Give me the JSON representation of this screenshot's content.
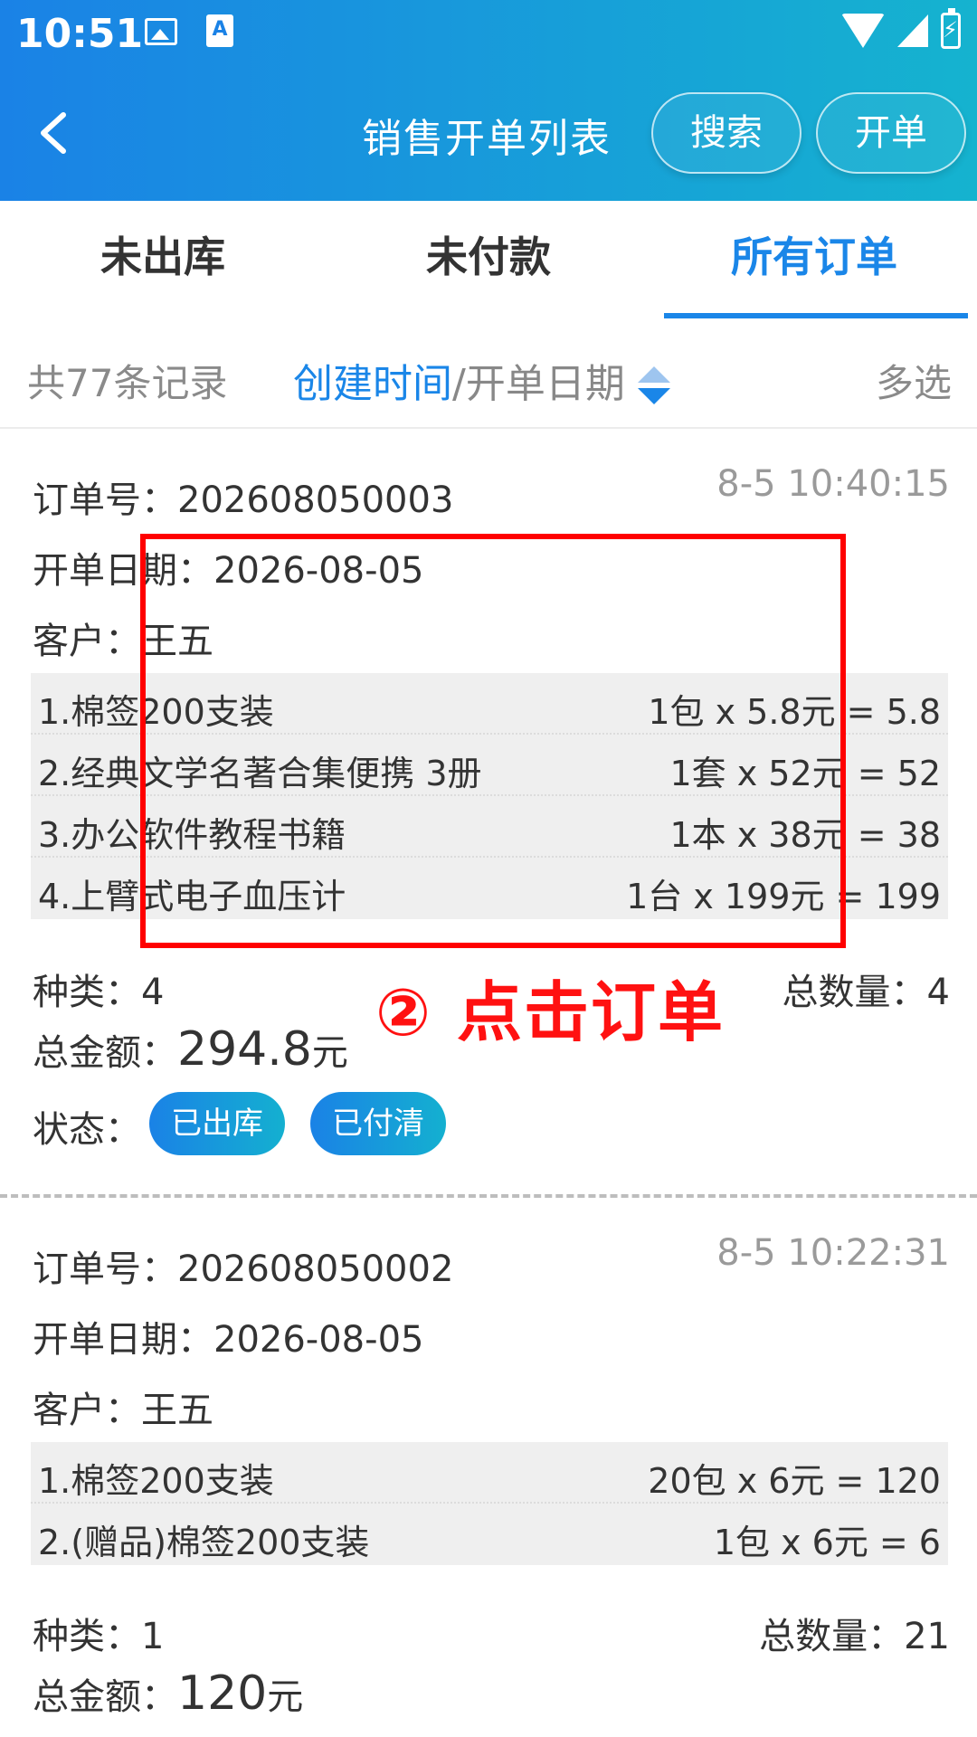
{
  "status_bar": {
    "time": "10:51",
    "a_icon": "A"
  },
  "app_bar": {
    "title": "销售开单列表",
    "search_label": "搜索",
    "new_label": "开单"
  },
  "tabs": [
    {
      "label": "未出库",
      "active": false
    },
    {
      "label": "未付款",
      "active": false
    },
    {
      "label": "所有订单",
      "active": true
    }
  ],
  "filter": {
    "count": "共77条记录",
    "sort_active": "创建时间",
    "sort_sep": "/",
    "sort_inactive": "开单日期",
    "multi": "多选"
  },
  "orders": [
    {
      "order_no_label": "订单号：",
      "order_no": "202608050003",
      "timestamp": "8-5 10:40:15",
      "date_label": "开单日期：",
      "date": "2026-08-05",
      "customer_label": "客户：",
      "customer": "王五",
      "items": [
        {
          "name": "1.棉签200支装",
          "calc": "1包 x 5.8元 = 5.8"
        },
        {
          "name": "2.经典文学名著合集便携 3册",
          "calc": "1套 x 52元 = 52"
        },
        {
          "name": "3.办公软件教程书籍",
          "calc": "1本 x 38元 = 38"
        },
        {
          "name": "4.上臂式电子血压计",
          "calc": "1台 x 199元 = 199"
        }
      ],
      "kinds_label": "种类：",
      "kinds": "4",
      "qty_label": "总数量：",
      "qty": "4",
      "total_label": "总金额：",
      "total": "294.8",
      "total_unit": "元",
      "status_label": "状态：",
      "badges": [
        "已出库",
        "已付清"
      ]
    },
    {
      "order_no_label": "订单号：",
      "order_no": "202608050002",
      "timestamp": "8-5 10:22:31",
      "date_label": "开单日期：",
      "date": "2026-08-05",
      "customer_label": "客户：",
      "customer": "王五",
      "items": [
        {
          "name": "1.棉签200支装",
          "calc": "20包 x 6元 = 120"
        },
        {
          "name": "2.(赠品)棉签200支装",
          "calc": "1包 x 6元 = 6"
        }
      ],
      "kinds_label": "种类：",
      "kinds": "1",
      "qty_label": "总数量：",
      "qty": "21",
      "total_label": "总金额：",
      "total": "120",
      "total_unit": "元"
    }
  ],
  "annotation": {
    "text": "② 点击订单",
    "color": "#ff0000"
  },
  "colors": {
    "accent": "#1a86e8",
    "gradient_start": "#1a82e6",
    "gradient_end": "#15b3cf"
  }
}
